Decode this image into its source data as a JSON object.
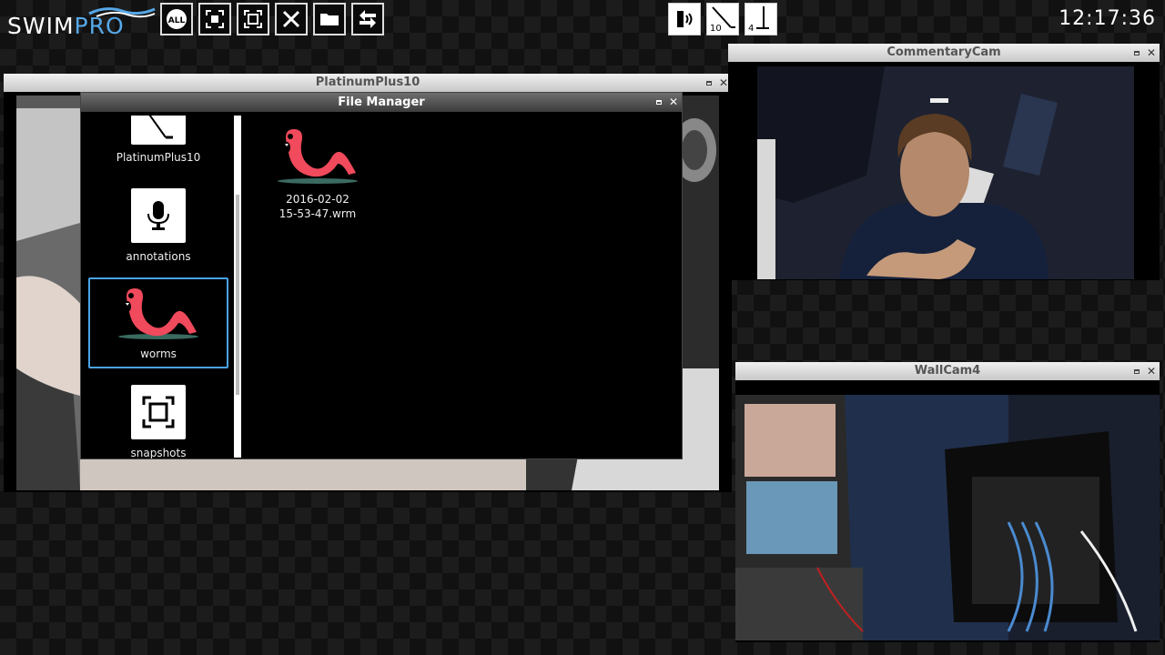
{
  "app": {
    "logo_main": "SWIM",
    "logo_accent": "PRO",
    "clock": "12:17:36"
  },
  "toolbar": {
    "buttons": [
      {
        "icon": "all-icon",
        "label": "ALL"
      },
      {
        "icon": "focus-icon"
      },
      {
        "icon": "fullscreen-icon"
      },
      {
        "icon": "tools-icon"
      },
      {
        "icon": "folder-icon"
      },
      {
        "icon": "swap-arrows-icon"
      }
    ],
    "wall_buttons": [
      {
        "icon": "audio-wall-icon",
        "number": ""
      },
      {
        "icon": "lane-line-icon",
        "number": "10"
      },
      {
        "icon": "lane-line-icon",
        "number": "4"
      }
    ]
  },
  "windows": {
    "platinum": {
      "title": "PlatinumPlus10"
    },
    "commentary": {
      "title": "CommentaryCam"
    },
    "wallcam": {
      "title": "WallCam4"
    }
  },
  "file_manager": {
    "title": "File Manager",
    "sidebar_items": [
      {
        "label": "PlatinumPlus10",
        "icon": "camera-pole-icon"
      },
      {
        "label": "annotations",
        "icon": "microphone-icon"
      },
      {
        "label": "worms",
        "icon": "worm-icon",
        "selected": true
      },
      {
        "label": "snapshots",
        "icon": "snapshot-icon"
      }
    ],
    "files": [
      {
        "name_line1": "2016-02-02",
        "name_line2": "15-53-47.wrm",
        "icon": "worm-icon"
      }
    ]
  },
  "colors": {
    "accent": "#4aa3e8",
    "worm": "#f04a5c",
    "logo_accent": "#56a8e8"
  }
}
